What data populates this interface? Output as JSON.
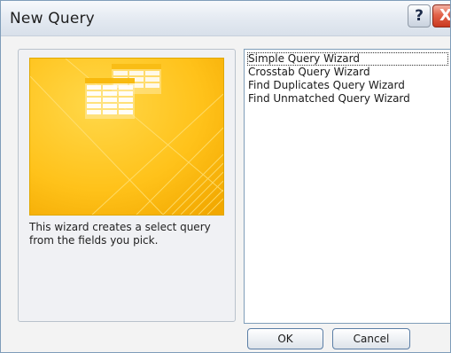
{
  "window": {
    "title": "New Query",
    "help_label": "?",
    "close_label": "X"
  },
  "wizard": {
    "description": "This wizard creates a select query from the fields you pick."
  },
  "query_types": {
    "items": [
      {
        "label": "Simple Query Wizard",
        "selected": true
      },
      {
        "label": "Crosstab Query Wizard",
        "selected": false
      },
      {
        "label": "Find Duplicates Query Wizard",
        "selected": false
      },
      {
        "label": "Find Unmatched Query Wizard",
        "selected": false
      }
    ]
  },
  "buttons": {
    "ok_label": "OK",
    "cancel_label": "Cancel"
  },
  "colors": {
    "preview_background": "#ffc61a",
    "close_button": "#d9432a",
    "list_border": "#7f9db9"
  }
}
